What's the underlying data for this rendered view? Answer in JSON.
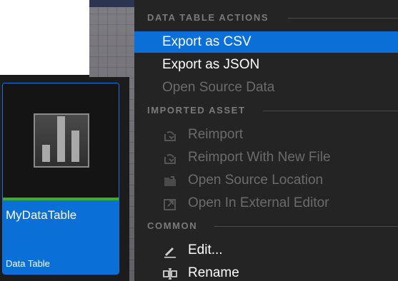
{
  "menu": {
    "sections": [
      {
        "title": "DATA TABLE ACTIONS",
        "items": [
          {
            "label": "Export as CSV"
          },
          {
            "label": "Export as JSON"
          },
          {
            "label": "Open Source Data"
          }
        ]
      },
      {
        "title": "IMPORTED ASSET",
        "items": [
          {
            "label": "Reimport",
            "icon": "reimport-icon"
          },
          {
            "label": "Reimport With New File",
            "icon": "reimport-new-file-icon"
          },
          {
            "label": "Open Source Location",
            "icon": "folder-icon"
          },
          {
            "label": "Open In External Editor",
            "icon": "external-editor-icon"
          }
        ]
      },
      {
        "title": "COMMON",
        "items": [
          {
            "label": "Edit...",
            "icon": "pencil-icon"
          },
          {
            "label": "Rename",
            "icon": "rename-icon"
          }
        ]
      }
    ],
    "highlight_color": "#0a6fd6"
  },
  "asset": {
    "name": "MyDataTable",
    "type": "Data Table",
    "thumbnail_icon": "bar-chart-icon",
    "accent_stripe": "#3fae2a",
    "tile_color": "#0a6fd6"
  }
}
